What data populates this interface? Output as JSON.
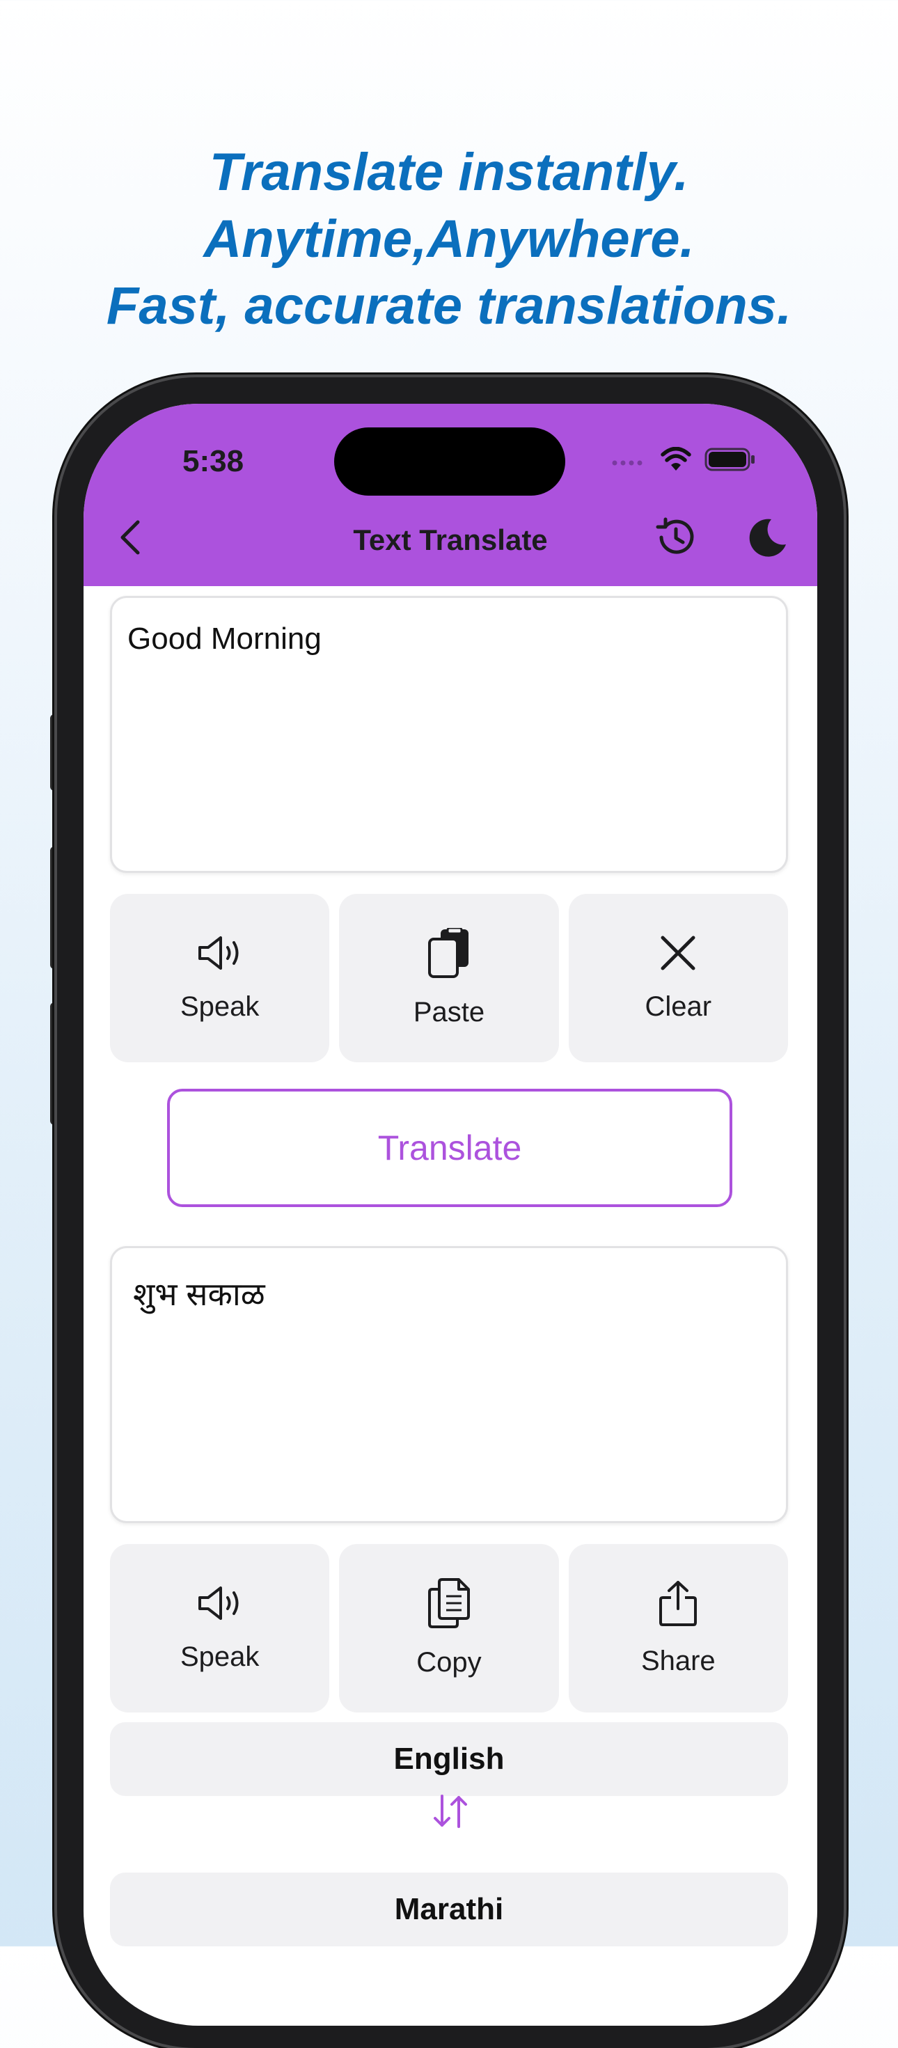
{
  "headline": {
    "line1": "Translate instantly.",
    "line2": "Anytime,Anywhere.",
    "line3": "Fast, accurate translations."
  },
  "status_bar": {
    "time": "5:38",
    "icons": [
      "cellular-signal-icon",
      "wifi-icon",
      "battery-icon"
    ]
  },
  "nav": {
    "title": "Text Translate",
    "back_icon": "chevron-left-icon",
    "history_icon": "history-icon",
    "theme_icon": "moon-icon"
  },
  "source": {
    "text": "Good Morning"
  },
  "source_actions": [
    {
      "label": "Speak",
      "icon": "speaker-icon"
    },
    {
      "label": "Paste",
      "icon": "paste-icon"
    },
    {
      "label": "Clear",
      "icon": "close-icon"
    }
  ],
  "translate_button": {
    "label": "Translate"
  },
  "target": {
    "text": "शुभ सकाळ"
  },
  "target_actions": [
    {
      "label": "Speak",
      "icon": "speaker-icon"
    },
    {
      "label": "Copy",
      "icon": "copy-icon"
    },
    {
      "label": "Share",
      "icon": "share-icon"
    }
  ],
  "languages": {
    "from": "English",
    "to": "Marathi",
    "swap_icon": "swap-arrows-icon"
  },
  "colors": {
    "accent": "#ac52dd",
    "headline": "#0b6fbd",
    "tile_bg": "#f1f1f3"
  }
}
